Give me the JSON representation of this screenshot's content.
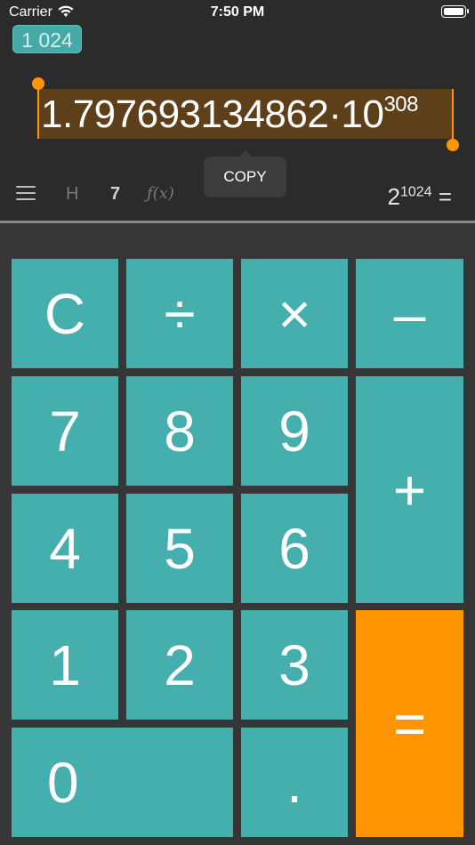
{
  "status_bar": {
    "carrier": "Carrier",
    "time": "7:50 PM",
    "icons": [
      "wifi-icon",
      "battery-icon"
    ]
  },
  "memory": {
    "value": "1 024"
  },
  "display": {
    "result_mantissa": "1.797693134862·10",
    "result_exponent": "308",
    "selection_color": "#5d401a",
    "handle_color": "#ff9500"
  },
  "context_menu": {
    "copy_label": "COPY"
  },
  "toolbar": {
    "menu_icon": "hamburger-menu-icon",
    "h_label": "H",
    "seven_label": "7",
    "fx_label": "ƒ(x)",
    "expression_base": "2",
    "expression_exponent": "1024",
    "expression_equals": "="
  },
  "keypad": {
    "accent_color": "#44afad",
    "equals_color": "#ff9500",
    "keys": {
      "clear": "C",
      "divide": "÷",
      "multiply": "×",
      "minus": "–",
      "seven": "7",
      "eight": "8",
      "nine": "9",
      "plus": "+",
      "four": "4",
      "five": "5",
      "six": "6",
      "one": "1",
      "two": "2",
      "three": "3",
      "equals": "=",
      "zero": "0",
      "decimal": "."
    }
  }
}
